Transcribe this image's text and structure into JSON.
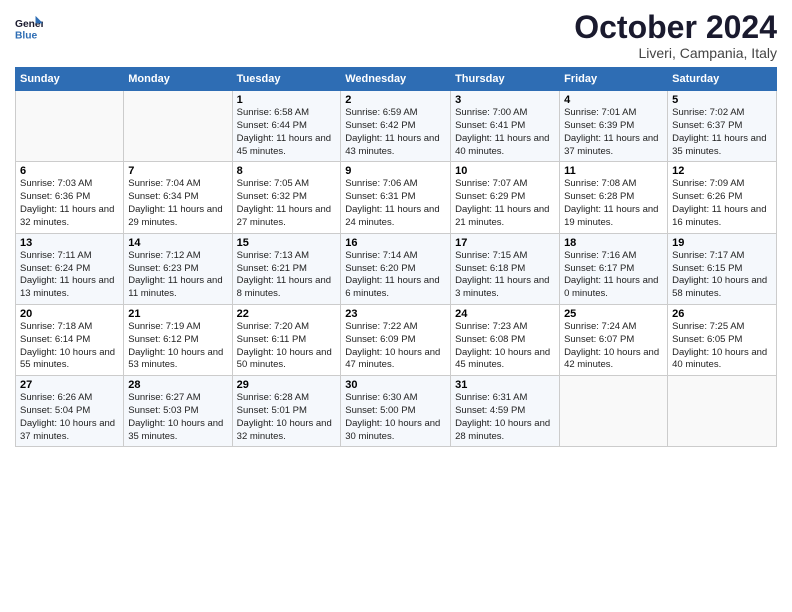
{
  "header": {
    "logo_general": "General",
    "logo_blue": "Blue",
    "month_title": "October 2024",
    "location": "Liveri, Campania, Italy"
  },
  "columns": [
    "Sunday",
    "Monday",
    "Tuesday",
    "Wednesday",
    "Thursday",
    "Friday",
    "Saturday"
  ],
  "weeks": [
    [
      {
        "day": "",
        "info": ""
      },
      {
        "day": "",
        "info": ""
      },
      {
        "day": "1",
        "info": "Sunrise: 6:58 AM\nSunset: 6:44 PM\nDaylight: 11 hours and 45 minutes."
      },
      {
        "day": "2",
        "info": "Sunrise: 6:59 AM\nSunset: 6:42 PM\nDaylight: 11 hours and 43 minutes."
      },
      {
        "day": "3",
        "info": "Sunrise: 7:00 AM\nSunset: 6:41 PM\nDaylight: 11 hours and 40 minutes."
      },
      {
        "day": "4",
        "info": "Sunrise: 7:01 AM\nSunset: 6:39 PM\nDaylight: 11 hours and 37 minutes."
      },
      {
        "day": "5",
        "info": "Sunrise: 7:02 AM\nSunset: 6:37 PM\nDaylight: 11 hours and 35 minutes."
      }
    ],
    [
      {
        "day": "6",
        "info": "Sunrise: 7:03 AM\nSunset: 6:36 PM\nDaylight: 11 hours and 32 minutes."
      },
      {
        "day": "7",
        "info": "Sunrise: 7:04 AM\nSunset: 6:34 PM\nDaylight: 11 hours and 29 minutes."
      },
      {
        "day": "8",
        "info": "Sunrise: 7:05 AM\nSunset: 6:32 PM\nDaylight: 11 hours and 27 minutes."
      },
      {
        "day": "9",
        "info": "Sunrise: 7:06 AM\nSunset: 6:31 PM\nDaylight: 11 hours and 24 minutes."
      },
      {
        "day": "10",
        "info": "Sunrise: 7:07 AM\nSunset: 6:29 PM\nDaylight: 11 hours and 21 minutes."
      },
      {
        "day": "11",
        "info": "Sunrise: 7:08 AM\nSunset: 6:28 PM\nDaylight: 11 hours and 19 minutes."
      },
      {
        "day": "12",
        "info": "Sunrise: 7:09 AM\nSunset: 6:26 PM\nDaylight: 11 hours and 16 minutes."
      }
    ],
    [
      {
        "day": "13",
        "info": "Sunrise: 7:11 AM\nSunset: 6:24 PM\nDaylight: 11 hours and 13 minutes."
      },
      {
        "day": "14",
        "info": "Sunrise: 7:12 AM\nSunset: 6:23 PM\nDaylight: 11 hours and 11 minutes."
      },
      {
        "day": "15",
        "info": "Sunrise: 7:13 AM\nSunset: 6:21 PM\nDaylight: 11 hours and 8 minutes."
      },
      {
        "day": "16",
        "info": "Sunrise: 7:14 AM\nSunset: 6:20 PM\nDaylight: 11 hours and 6 minutes."
      },
      {
        "day": "17",
        "info": "Sunrise: 7:15 AM\nSunset: 6:18 PM\nDaylight: 11 hours and 3 minutes."
      },
      {
        "day": "18",
        "info": "Sunrise: 7:16 AM\nSunset: 6:17 PM\nDaylight: 11 hours and 0 minutes."
      },
      {
        "day": "19",
        "info": "Sunrise: 7:17 AM\nSunset: 6:15 PM\nDaylight: 10 hours and 58 minutes."
      }
    ],
    [
      {
        "day": "20",
        "info": "Sunrise: 7:18 AM\nSunset: 6:14 PM\nDaylight: 10 hours and 55 minutes."
      },
      {
        "day": "21",
        "info": "Sunrise: 7:19 AM\nSunset: 6:12 PM\nDaylight: 10 hours and 53 minutes."
      },
      {
        "day": "22",
        "info": "Sunrise: 7:20 AM\nSunset: 6:11 PM\nDaylight: 10 hours and 50 minutes."
      },
      {
        "day": "23",
        "info": "Sunrise: 7:22 AM\nSunset: 6:09 PM\nDaylight: 10 hours and 47 minutes."
      },
      {
        "day": "24",
        "info": "Sunrise: 7:23 AM\nSunset: 6:08 PM\nDaylight: 10 hours and 45 minutes."
      },
      {
        "day": "25",
        "info": "Sunrise: 7:24 AM\nSunset: 6:07 PM\nDaylight: 10 hours and 42 minutes."
      },
      {
        "day": "26",
        "info": "Sunrise: 7:25 AM\nSunset: 6:05 PM\nDaylight: 10 hours and 40 minutes."
      }
    ],
    [
      {
        "day": "27",
        "info": "Sunrise: 6:26 AM\nSunset: 5:04 PM\nDaylight: 10 hours and 37 minutes."
      },
      {
        "day": "28",
        "info": "Sunrise: 6:27 AM\nSunset: 5:03 PM\nDaylight: 10 hours and 35 minutes."
      },
      {
        "day": "29",
        "info": "Sunrise: 6:28 AM\nSunset: 5:01 PM\nDaylight: 10 hours and 32 minutes."
      },
      {
        "day": "30",
        "info": "Sunrise: 6:30 AM\nSunset: 5:00 PM\nDaylight: 10 hours and 30 minutes."
      },
      {
        "day": "31",
        "info": "Sunrise: 6:31 AM\nSunset: 4:59 PM\nDaylight: 10 hours and 28 minutes."
      },
      {
        "day": "",
        "info": ""
      },
      {
        "day": "",
        "info": ""
      }
    ]
  ]
}
